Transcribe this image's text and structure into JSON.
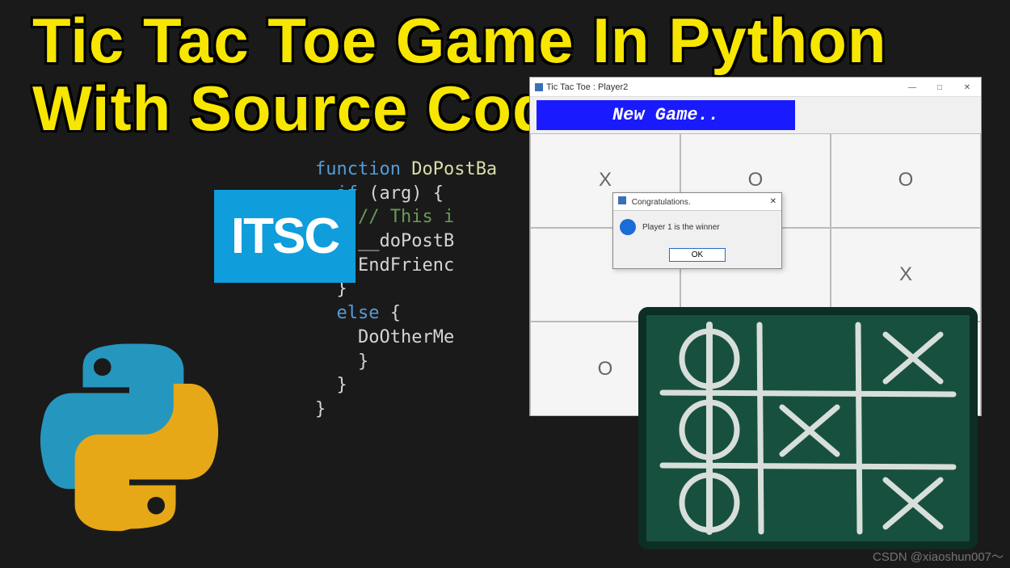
{
  "headline": {
    "line1": "Tic Tac Toe Game In Python",
    "line2": "With Source Code"
  },
  "itsc_logo_text": "ITSC",
  "code": "function DoPostBa\n  if (arg) {\n    // This i\n    __doPostB\n    EndFrienc\n  }\n  else {\n    DoOtherMe\n    }\n  }\n}",
  "game_window": {
    "title": "Tic Tac Toe : Player2",
    "new_game_button": "New Game..",
    "grid": [
      "X",
      "O",
      "O",
      "",
      "",
      "X",
      "O",
      "",
      ""
    ]
  },
  "dialog": {
    "title": "Congratulations.",
    "message": "Player 1 is the winner",
    "ok": "OK"
  },
  "chalkboard": {
    "cells": [
      "O",
      "",
      "X",
      "",
      "X",
      "",
      "O",
      "",
      "X"
    ]
  },
  "watermark": "CSDN @xiaoshun007～"
}
